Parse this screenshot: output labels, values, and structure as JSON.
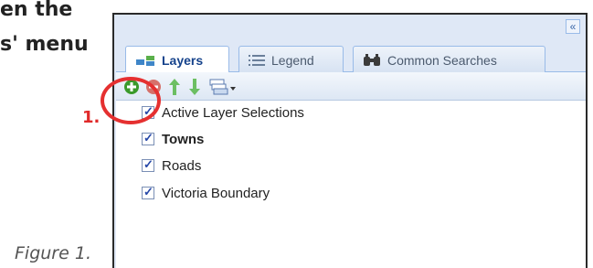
{
  "document": {
    "line1": "en the",
    "line2": "s' menu",
    "step_label": "1.",
    "caption": "Figure 1."
  },
  "panel": {
    "collapse_glyph": "«",
    "tabs": [
      {
        "label": "Layers",
        "icon": "layers-icon",
        "active": true
      },
      {
        "label": "Legend",
        "icon": "legend-list-icon",
        "active": false
      },
      {
        "label": "Common Searches",
        "icon": "binoculars-icon",
        "active": false
      }
    ],
    "toolbar": {
      "add": {
        "icon": "add-layer-icon",
        "color": "#3a9a2a"
      },
      "remove": {
        "icon": "remove-layer-icon",
        "color": "#d0453a"
      },
      "up": {
        "icon": "move-up-icon",
        "color": "#4db33d"
      },
      "down": {
        "icon": "move-down-icon",
        "color": "#4db33d"
      },
      "menu": {
        "icon": "layer-options-icon"
      }
    },
    "layers": [
      {
        "label": "Active Layer Selections",
        "checked": true,
        "bold": false
      },
      {
        "label": "Towns",
        "checked": true,
        "bold": true
      },
      {
        "label": "Roads",
        "checked": true,
        "bold": false
      },
      {
        "label": "Victoria Boundary",
        "checked": true,
        "bold": false
      }
    ]
  },
  "colors": {
    "accent_ring": "#e53030",
    "panel_bg": "#dfe8f6",
    "tab_border": "#99bbe8"
  }
}
